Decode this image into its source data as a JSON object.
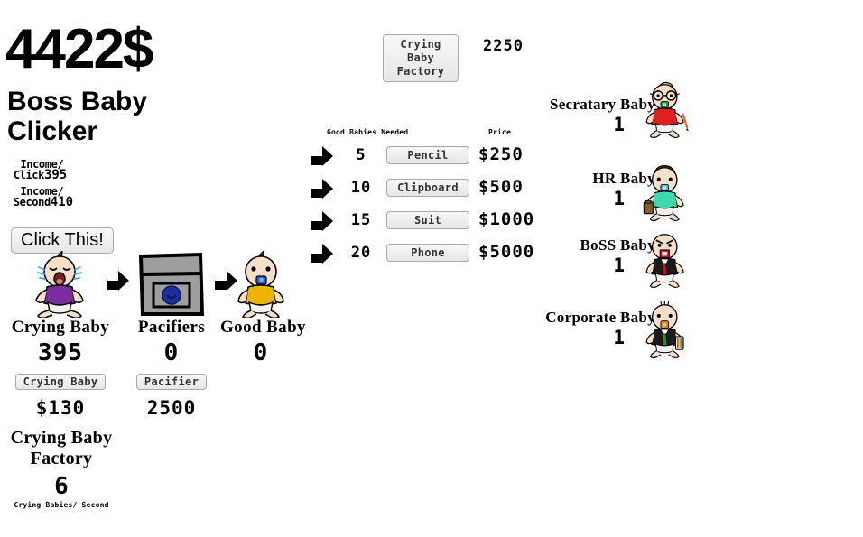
{
  "header": {
    "money": "4422$",
    "title_line1": "Boss Baby",
    "title_line2": "Clicker",
    "income_click_label": "Income/\n Click",
    "income_click_value": "395",
    "income_second_label": "Income/\n Second",
    "income_second_value": "410"
  },
  "main_click": {
    "button_label": "Click This!"
  },
  "chain": {
    "crying_baby": {
      "name": "Crying Baby",
      "count": "395",
      "buy_label": "Crying Baby",
      "price": "$130",
      "sprite": "crying-baby-sprite"
    },
    "pacifiers": {
      "name": "Pacifiers",
      "count": "0",
      "buy_label": "Pacifier",
      "price": "2500",
      "sprite": "pacifier-bag-sprite"
    },
    "good_baby": {
      "name": "Good Baby",
      "count": "0",
      "sprite": "good-baby-sprite"
    }
  },
  "factory": {
    "title_line1": "Crying Baby",
    "title_line2": "Factory",
    "count": "6",
    "rate_label": "Crying Babies/ Second",
    "buy_label_line1": "Crying Baby",
    "buy_label_line2": "Factory",
    "buy_price": "2250"
  },
  "upgrades": {
    "header_needed": "Good Babies Needed",
    "header_price": "Price",
    "rows": [
      {
        "needed": "5",
        "label": "Pencil",
        "price": "$250"
      },
      {
        "needed": "10",
        "label": "Clipboard",
        "price": "$500"
      },
      {
        "needed": "15",
        "label": "Suit",
        "price": "$1000"
      },
      {
        "needed": "20",
        "label": "Phone",
        "price": "$5000"
      }
    ]
  },
  "roster": [
    {
      "label": "Secratary Baby",
      "count": "1",
      "sprite": "secretary-baby-sprite"
    },
    {
      "label": "HR Baby",
      "count": "1",
      "sprite": "hr-baby-sprite"
    },
    {
      "label": "BoSS Baby",
      "count": "1",
      "sprite": "boss-baby-sprite"
    },
    {
      "label": "Corporate Baby",
      "count": "1",
      "sprite": "corporate-baby-sprite"
    }
  ],
  "colors": {
    "crying_shirt": "#7B2D9E",
    "good_shirt": "#F0B400",
    "secretary_shirt": "#E02020",
    "hr_shirt": "#3FD9B0",
    "suit_black": "#1A1A1A",
    "boss_tie": "#CC1111",
    "corporate_tie": "#2E8B2E",
    "skin": "#F6DFC8",
    "bag_gray": "#9E9E9E",
    "pacifier_blue": "#1B2F9E"
  }
}
